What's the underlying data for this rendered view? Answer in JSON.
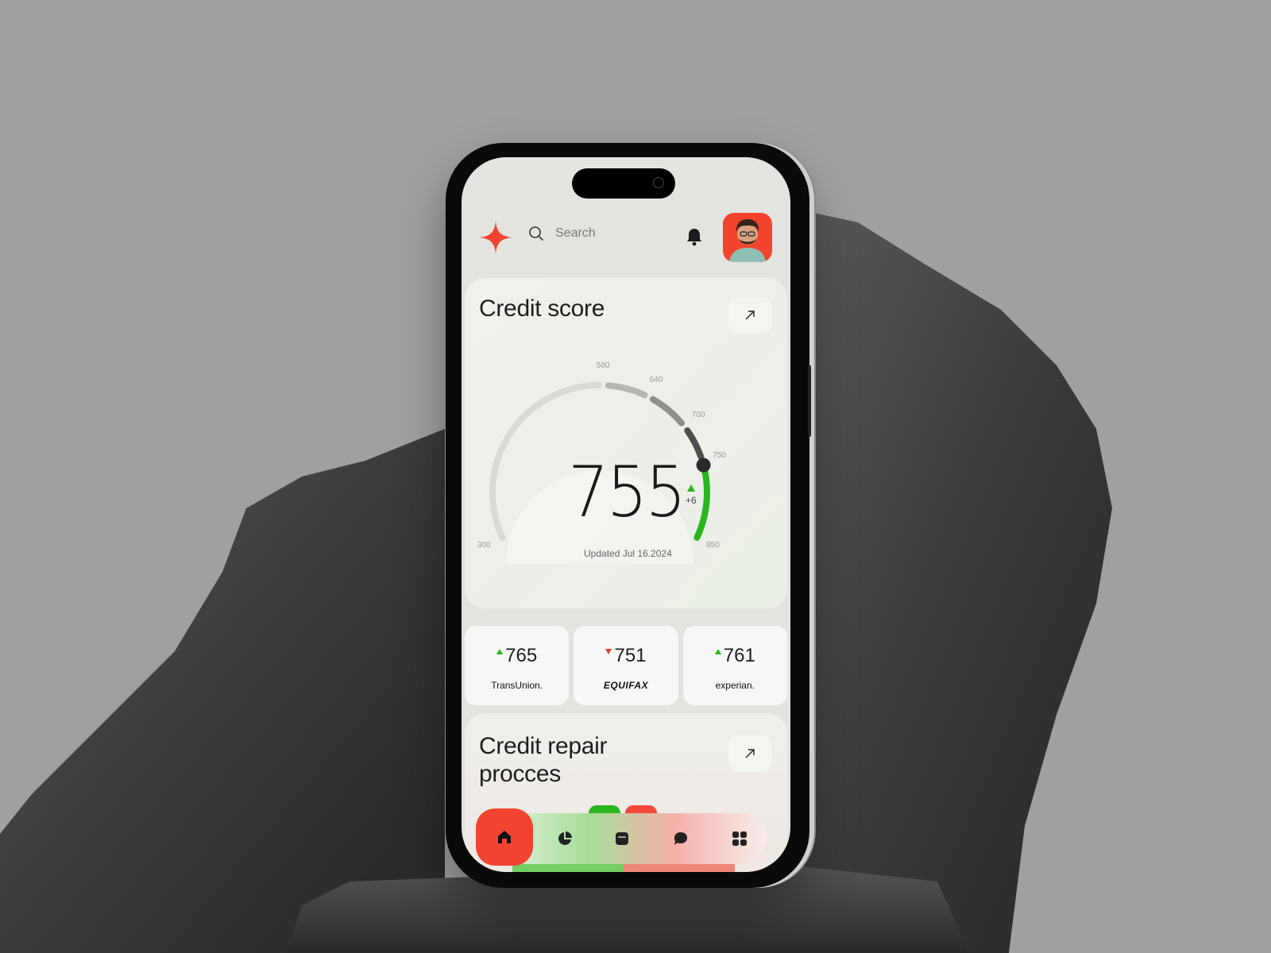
{
  "header": {
    "search_placeholder": "Search",
    "icons": [
      "sparkle-logo-icon",
      "search-icon",
      "bell-icon",
      "avatar"
    ]
  },
  "credit_score": {
    "title": "Credit score",
    "score": "755",
    "delta": "+6",
    "delta_direction": "up",
    "updated": "Updated Jul 16.2024",
    "range_min": 300,
    "range_max": 850,
    "ticks": [
      "300",
      "580",
      "640",
      "700",
      "750",
      "850"
    ],
    "score_value": 755,
    "colors": {
      "track": "#d9d9d6",
      "seg_580_640": "#b4b6b1",
      "seg_640_700": "#8e908c",
      "seg_700_750": "#4e4f4d",
      "seg_750_850": "#2bb51f",
      "marker": "#2a2a2a"
    }
  },
  "bureaus": [
    {
      "name": "TransUnion.",
      "score": "765",
      "trend": "up"
    },
    {
      "name": "EQUIFAX",
      "score": "751",
      "trend": "down"
    },
    {
      "name": "experian.",
      "score": "761",
      "trend": "up"
    }
  ],
  "credit_repair": {
    "title_line1": "Credit repair",
    "title_line2": "procces"
  },
  "nav": {
    "items": [
      {
        "name": "home",
        "icon": "home-icon",
        "active": true
      },
      {
        "name": "analytics",
        "icon": "pie-chart-icon",
        "active": false
      },
      {
        "name": "wallet",
        "icon": "wallet-icon",
        "active": false
      },
      {
        "name": "chat",
        "icon": "chat-icon",
        "active": false
      },
      {
        "name": "apps",
        "icon": "grid-icon",
        "active": false
      }
    ]
  },
  "colors": {
    "accent": "#f24430",
    "positive": "#2bb51f",
    "negative": "#e33b2a",
    "background": "#a0a0a0"
  }
}
